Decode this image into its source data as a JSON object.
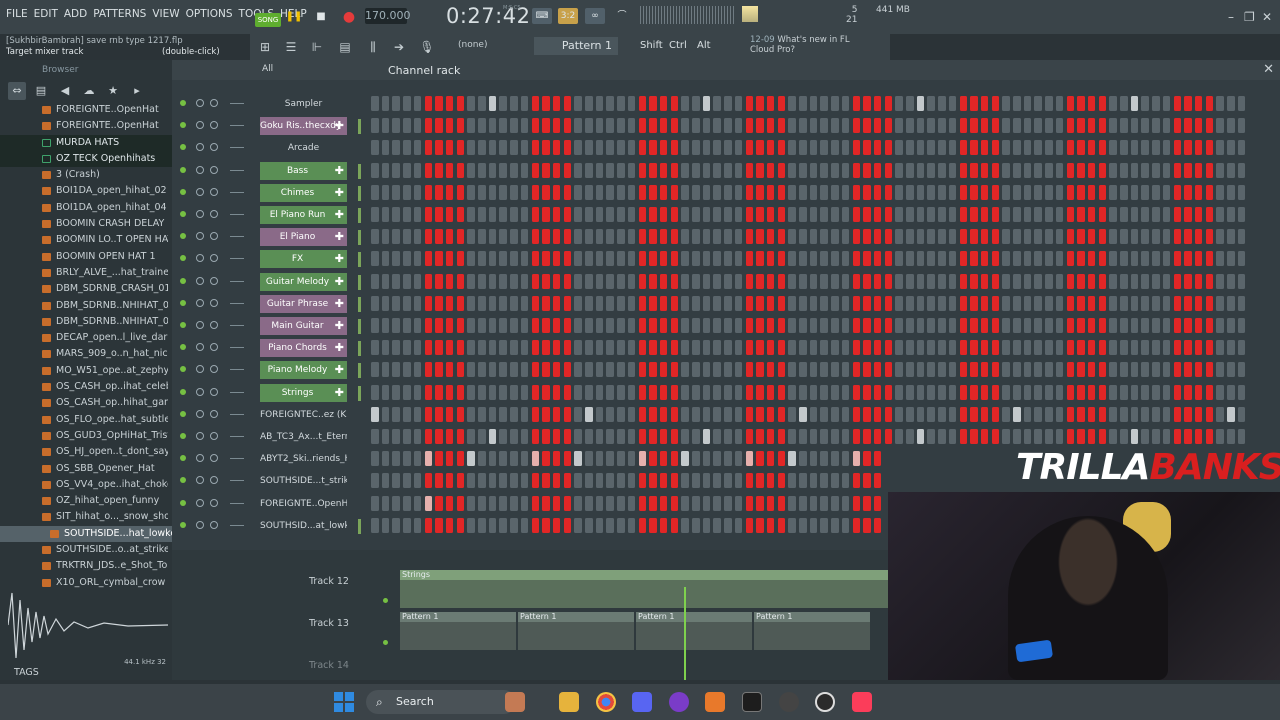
{
  "menu": [
    "FILE",
    "EDIT",
    "ADD",
    "PATTERNS",
    "VIEW",
    "OPTIONS",
    "TOOLS",
    "HELP"
  ],
  "transport": {
    "song_label": "SONG",
    "tempo": "170.000",
    "time": "0:27:42",
    "time_unit": "M:S:CS",
    "cpu": "5",
    "cpu2": "21",
    "memory": "441 MB"
  },
  "hint": {
    "project": "[SukhbirBambrah] save rnb type 1217.flp",
    "line2": "Target mixer track",
    "line3": "(double-click)"
  },
  "toolbar2": {
    "none": "(none)",
    "pattern": "Pattern 1",
    "shift": "Shift",
    "ctrl": "Ctrl",
    "alt": "Alt",
    "news_date": "12-09",
    "news_line1": "What's new in FL",
    "news_line2": "Cloud Pro?"
  },
  "browser": {
    "title": "Browser",
    "filter_all": "All",
    "items": [
      {
        "label": "FOREIGNTE..OpenHat",
        "type": "file"
      },
      {
        "label": "FOREIGNTE..OpenHat",
        "type": "file"
      },
      {
        "label": "MURDA HATS",
        "type": "folder"
      },
      {
        "label": "OZ TECK Openhihats",
        "type": "folder"
      },
      {
        "label": "3 (Crash)",
        "type": "file"
      },
      {
        "label": "BOI1DA_open_hihat_02",
        "type": "file"
      },
      {
        "label": "BOI1DA_open_hihat_04",
        "type": "file"
      },
      {
        "label": "BOOMIN CRASH DELAY",
        "type": "file"
      },
      {
        "label": "BOOMIN LO..T OPEN HAT",
        "type": "file"
      },
      {
        "label": "BOOMIN OPEN HAT 1",
        "type": "file"
      },
      {
        "label": "BRLY_ALVE_...hat_trained",
        "type": "file"
      },
      {
        "label": "DBM_SDRNB_CRASH_01",
        "type": "file"
      },
      {
        "label": "DBM_SDRNB..NHIHAT_02",
        "type": "file"
      },
      {
        "label": "DBM_SDRNB..NHIHAT_07",
        "type": "file"
      },
      {
        "label": "DECAP_open..l_live_dark",
        "type": "file"
      },
      {
        "label": "MARS_909_o..n_hat_nice",
        "type": "file"
      },
      {
        "label": "MO_W51_ope..at_zephyr",
        "type": "file"
      },
      {
        "label": "OS_CASH_op..ihat_celeb",
        "type": "file"
      },
      {
        "label": "OS_CASH_op..hihat_gang",
        "type": "file"
      },
      {
        "label": "OS_FLO_ope..hat_subtle",
        "type": "file"
      },
      {
        "label": "OS_GUD3_OpHiHat_Trist",
        "type": "file"
      },
      {
        "label": "OS_HJ_open..t_dont_say",
        "type": "file"
      },
      {
        "label": "OS_SBB_Opener_Hat",
        "type": "file"
      },
      {
        "label": "OS_VV4_ope..ihat_choke",
        "type": "file"
      },
      {
        "label": "OZ_hihat_open_funny",
        "type": "file"
      },
      {
        "label": "SIT_hihat_o..._snow_shoe",
        "type": "file"
      },
      {
        "label": "SOUTHSIDE...hat_lowkey",
        "type": "selected"
      },
      {
        "label": "SOUTHSIDE..o..at_strikers",
        "type": "file"
      },
      {
        "label": "TRKTRN_JDS..e_Shot_Top",
        "type": "file"
      },
      {
        "label": "X10_ORL_cymbal_crow",
        "type": "file"
      }
    ],
    "preview_info": "44.1 kHz 32",
    "tags": "TAGS"
  },
  "rack": {
    "title": "Channel rack",
    "all": "All",
    "channels": [
      {
        "name": "Sampler",
        "style": "plain",
        "pattern": "A"
      },
      {
        "name": "Goku Ris..thecxdy",
        "style": "purple",
        "pattern": "A"
      },
      {
        "name": "Arcade",
        "style": "plain",
        "pattern": "A"
      },
      {
        "name": "Bass",
        "style": "green",
        "pattern": "A"
      },
      {
        "name": "Chimes",
        "style": "green",
        "pattern": "A"
      },
      {
        "name": "El Piano Run",
        "style": "green",
        "pattern": "A"
      },
      {
        "name": "El Piano",
        "style": "purple",
        "pattern": "A"
      },
      {
        "name": "FX",
        "style": "green",
        "pattern": "A"
      },
      {
        "name": "Guitar Melody",
        "style": "green",
        "pattern": "A"
      },
      {
        "name": "Guitar Phrase",
        "style": "purple",
        "pattern": "A"
      },
      {
        "name": "Main Guitar",
        "style": "purple",
        "pattern": "A"
      },
      {
        "name": "Piano Chords",
        "style": "purple",
        "pattern": "A"
      },
      {
        "name": "Piano Melody",
        "style": "green",
        "pattern": "A"
      },
      {
        "name": "Strings",
        "style": "green",
        "pattern": "A"
      },
      {
        "name": "FOREIGNTEC..ez (Kick)",
        "style": "plain",
        "pattern": "K"
      },
      {
        "name": "AB_TC3_Ax...t_Eternal",
        "style": "plain",
        "pattern": "A"
      },
      {
        "name": "ABYT2_Ski..riends_HH",
        "style": "plain",
        "pattern": "H"
      },
      {
        "name": "SOUTHSIDE...t_strikers",
        "style": "plain",
        "pattern": "A"
      },
      {
        "name": "FOREIGNTE..OpenHat)",
        "style": "plain",
        "pattern": "O"
      },
      {
        "name": "SOUTHSID...at_lowkey",
        "style": "plain",
        "pattern": "A"
      }
    ]
  },
  "playlist": {
    "tracks": [
      {
        "label": "Track 12",
        "clip": "Strings"
      },
      {
        "label": "Track 13",
        "clip": "Pattern 1"
      },
      {
        "label": "Track 14",
        "clip": ""
      }
    ]
  },
  "overlay": {
    "brand_1": "TRILLA",
    "brand_2": "BANKS"
  },
  "taskbar": {
    "search": "Search"
  },
  "colors": {
    "step_on": "#e22626",
    "step_off": "#5a656b",
    "accent_green": "#5fae2f"
  }
}
